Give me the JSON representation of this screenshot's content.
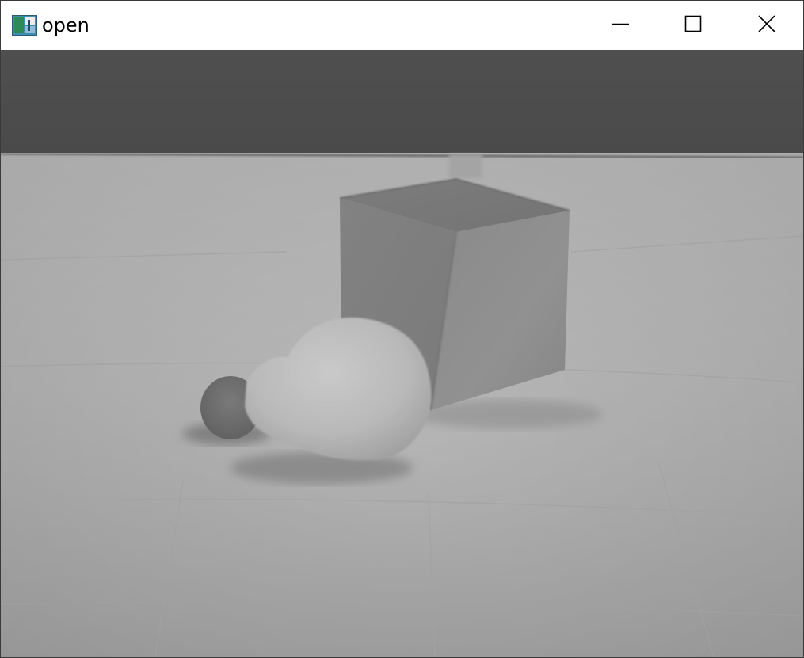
{
  "window": {
    "title": "open",
    "app_icon": "opencv-highgui-window-icon",
    "controls": {
      "minimize": "minimize-icon",
      "maximize": "maximize-icon",
      "close": "close-icon"
    }
  },
  "image": {
    "mode": "grayscale",
    "subject": "light-bulb-and-cube-on-tiled-floor"
  }
}
